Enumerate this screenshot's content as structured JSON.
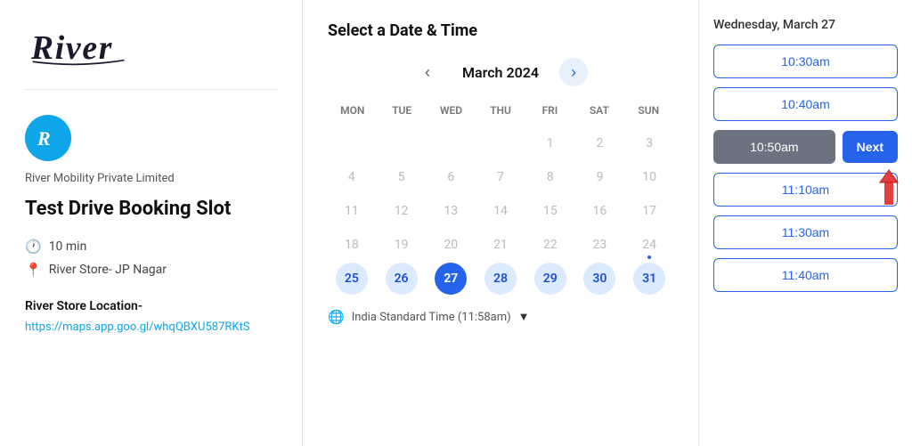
{
  "logo": {
    "text": "River",
    "icon_letter": "R"
  },
  "left_panel": {
    "brand_name": "River Mobility Private Limited",
    "service_title": "Test Drive Booking Slot",
    "duration": "10 min",
    "location": "River Store- JP Nagar",
    "location_label": "River Store Location-",
    "location_link_text": "https://maps.app.goo.gl/whqQBXU587RKtS",
    "location_link_href": "https://maps.app.goo.gl/whqQBXU587RKtS"
  },
  "calendar": {
    "section_title": "Select a Date & Time",
    "month_label": "March 2024",
    "prev_btn": "‹",
    "next_btn": "›",
    "day_headers": [
      "MON",
      "TUE",
      "WED",
      "THU",
      "FRI",
      "SAT",
      "SUN"
    ],
    "weeks": [
      [
        null,
        null,
        null,
        null,
        1,
        2,
        3
      ],
      [
        4,
        5,
        6,
        7,
        8,
        9,
        10
      ],
      [
        11,
        12,
        13,
        14,
        15,
        16,
        17
      ],
      [
        18,
        19,
        20,
        21,
        22,
        23,
        24
      ],
      [
        25,
        26,
        27,
        28,
        29,
        30,
        31
      ]
    ],
    "highlighted_days": [
      25,
      26,
      27,
      28,
      29,
      30,
      31
    ],
    "selected_day": 27,
    "dot_day": 24,
    "timezone_label": "India Standard Time (11:58am)",
    "timezone_icon": "🌐"
  },
  "timeslot_panel": {
    "date_label": "Wednesday, March 27",
    "slots": [
      {
        "time": "10:30am",
        "state": "normal"
      },
      {
        "time": "10:40am",
        "state": "normal"
      },
      {
        "time": "10:50am",
        "state": "selected"
      },
      {
        "time": "11:10am",
        "state": "normal"
      },
      {
        "time": "11:30am",
        "state": "normal"
      },
      {
        "time": "11:40am",
        "state": "normal"
      }
    ],
    "next_label": "Next",
    "selected_slot_index": 2
  }
}
